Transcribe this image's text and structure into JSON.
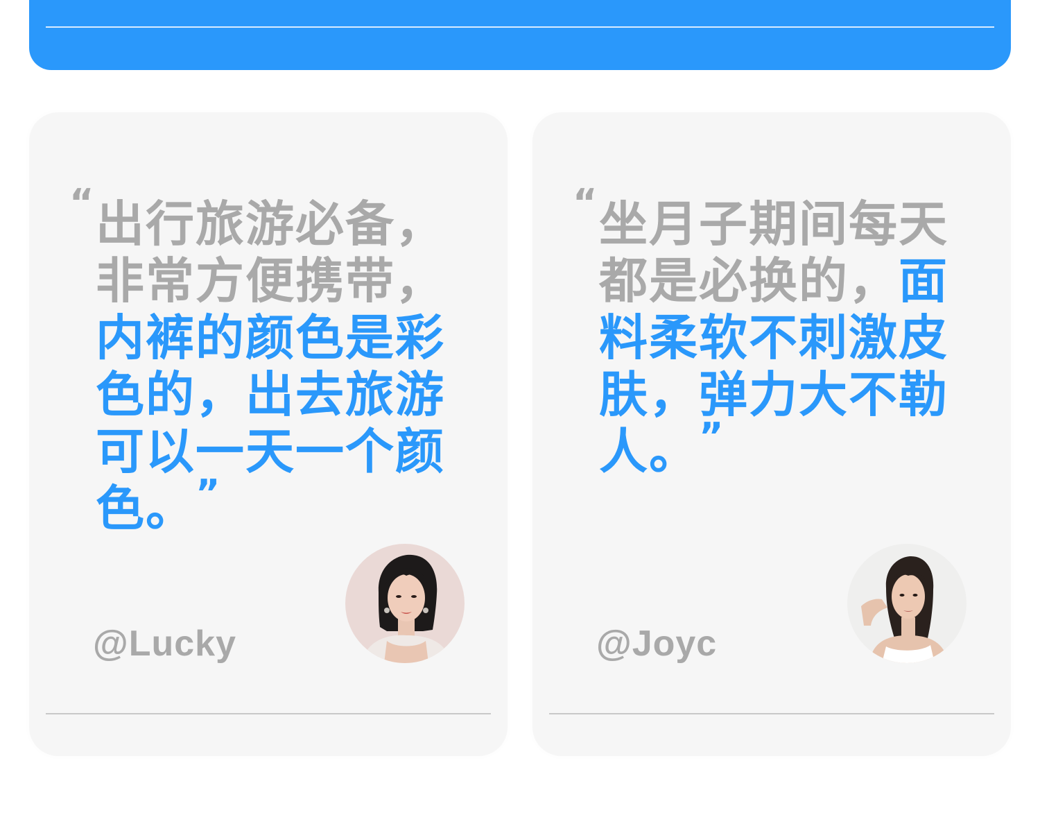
{
  "colors": {
    "accent": "#2a98fb",
    "quote_gray": "#a9a9a9",
    "card_bg": "#f6f6f6"
  },
  "reviews": [
    {
      "open_mark": "“",
      "text_gray": "出行旅游必备，非常方便携带，",
      "text_blue": "内裤的颜色是彩色的，出去旅游可以一天一个颜色。",
      "close_mark": "”",
      "handle": "@Lucky",
      "avatar_icon": "woman-portrait-short-hair-icon"
    },
    {
      "open_mark": "“",
      "text_gray": "坐月子期间每天都是必换的，",
      "text_blue": "面料柔软不刺激皮肤，弹力大不勒人。",
      "close_mark": "”",
      "handle": "@Joyc",
      "avatar_icon": "woman-portrait-long-hair-icon"
    }
  ]
}
